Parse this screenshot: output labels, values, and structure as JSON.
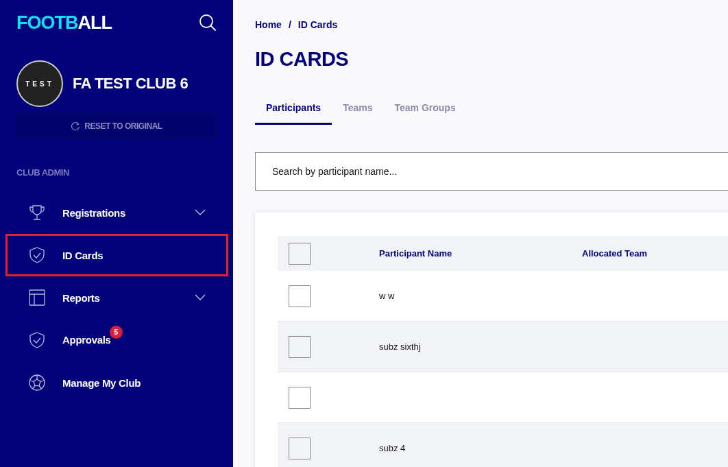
{
  "sidebar": {
    "logo": {
      "accent": "FOOTB",
      "rest": "ALL"
    },
    "club": {
      "avatar": "TEST",
      "name": "FA TEST CLUB 6"
    },
    "reset_button": "RESET TO ORIGINAL",
    "section_label": "CLUB ADMIN",
    "items": [
      {
        "label": "Registrations",
        "expandable": true,
        "selected": false
      },
      {
        "label": "ID Cards",
        "expandable": false,
        "selected": true
      },
      {
        "label": "Reports",
        "expandable": true,
        "selected": false
      },
      {
        "label": "Approvals",
        "expandable": false,
        "selected": false,
        "badge": "5"
      },
      {
        "label": "Manage My Club",
        "expandable": false,
        "selected": false
      }
    ]
  },
  "breadcrumb": [
    "Home",
    "/",
    "ID Cards"
  ],
  "title": "ID CARDS",
  "tabs": [
    {
      "label": "Participants",
      "selected": true
    },
    {
      "label": "Teams",
      "selected": false
    },
    {
      "label": "Team Groups",
      "selected": false
    }
  ],
  "search": {
    "placeholder": "Search by participant name..."
  },
  "table": {
    "header_checked": false,
    "columns": [
      "Participant Name",
      "Allocated Team"
    ],
    "rows": [
      {
        "checked": false,
        "name": "w w"
      },
      {
        "checked": false,
        "name": "subz sixthj"
      },
      {
        "checked": false
      },
      {
        "checked": false,
        "name": "subz 4"
      }
    ]
  }
}
